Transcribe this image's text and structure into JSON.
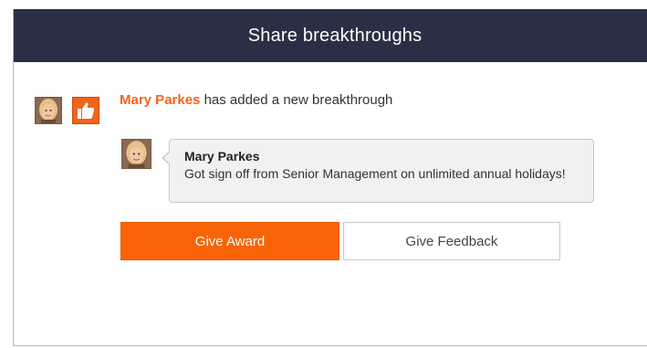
{
  "dialog": {
    "title": "Share breakthroughs"
  },
  "activity": {
    "actor_name": "Mary Parkes",
    "action_text": " has added a new breakthrough",
    "badge_icon": "thumbs-up-icon"
  },
  "post": {
    "author": "Mary Parkes",
    "text": "Got sign off from Senior Management on unlimited annual holidays!"
  },
  "actions": {
    "primary_label": "Give Award",
    "secondary_label": "Give Feedback"
  },
  "colors": {
    "header_bg": "#2b2f45",
    "accent": "#f96307",
    "link": "#f26419"
  }
}
